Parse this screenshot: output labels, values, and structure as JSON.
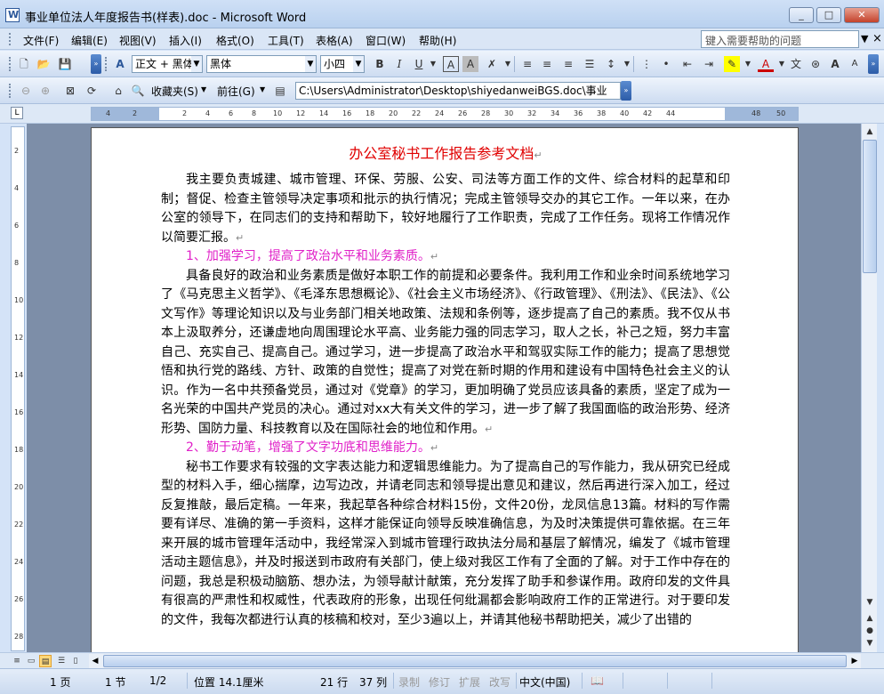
{
  "window": {
    "title": "事业单位法人年度报告书(样表).doc - Microsoft Word",
    "min": "_",
    "max": "□",
    "close": "✕"
  },
  "menu": {
    "items": [
      "文件(F)",
      "编辑(E)",
      "视图(V)",
      "插入(I)",
      "格式(O)",
      "工具(T)",
      "表格(A)",
      "窗口(W)",
      "帮助(H)"
    ],
    "help_placeholder": "键入需要帮助的问题",
    "close": "×"
  },
  "formatting": {
    "style": "正文 + 黑体",
    "font": "黑体",
    "size": "小四"
  },
  "web": {
    "favorites": "收藏夹(S)",
    "goto": "前往(G)",
    "address": "C:\\Users\\Administrator\\Desktop\\shiyedanweiBGS.doc\\事业"
  },
  "ruler": {
    "ticks": [
      "4",
      "2",
      "2",
      "4",
      "6",
      "8",
      "10",
      "12",
      "14",
      "16",
      "18",
      "20",
      "22",
      "24",
      "26",
      "28",
      "30",
      "32",
      "34",
      "36",
      "38",
      "40",
      "42",
      "44",
      "48",
      "50"
    ],
    "vticks": [
      "2",
      "4",
      "6",
      "8",
      "10",
      "12",
      "14",
      "16",
      "18",
      "20",
      "22",
      "24",
      "26",
      "28"
    ]
  },
  "document": {
    "title": "办公室秘书工作报告参考文档",
    "paragraphs": [
      {
        "type": "para",
        "text": "我主要负责城建、城市管理、环保、劳服、公安、司法等方面工作的文件、综合材料的起草和印制；督促、检查主管领导决定事项和批示的执行情况；完成主管领导交办的其它工作。一年以来，在办公室的领导下，在同志们的支持和帮助下，较好地履行了工作职责，完成了工作任务。现将工作情况作以简要汇报。"
      },
      {
        "type": "heading",
        "text": "1、加强学习，提高了政治水平和业务素质。"
      },
      {
        "type": "para",
        "text": "具备良好的政治和业务素质是做好本职工作的前提和必要条件。我利用工作和业余时间系统地学习了《马克思主义哲学》、《毛泽东思想概论》、《社会主义市场经济》、《行政管理》、《刑法》、《民法》、《公文写作》等理论知识以及与业务部门相关地政策、法规和条例等，逐步提高了自己的素质。我不仅从书本上汲取养分，还谦虚地向周围理论水平高、业务能力强的同志学习，取人之长，补己之短，努力丰富自己、充实自己、提高自己。通过学习，进一步提高了政治水平和驾驭实际工作的能力；提高了思想觉悟和执行党的路线、方针、政策的自觉性；提高了对党在新时期的作用和建设有中国特色社会主义的认识。作为一名中共预备党员，通过对《党章》的学习，更加明确了党员应该具备的素质，坚定了成为一名光荣的中国共产党员的决心。通过对xx大有关文件的学习，进一步了解了我国面临的政治形势、经济形势、国防力量、科技教育以及在国际社会的地位和作用。"
      },
      {
        "type": "heading",
        "text": "2、勤于动笔，增强了文字功底和思维能力。"
      },
      {
        "type": "para",
        "text": "秘书工作要求有较强的文字表达能力和逻辑思维能力。为了提高自己的写作能力，我从研究已经成型的材料入手，细心揣摩，边写边改，并请老同志和领导提出意见和建议，然后再进行深入加工，经过反复推敲，最后定稿。一年来，我起草各种综合材料15份，文件20份，龙凤信息13篇。材料的写作需要有详尽、准确的第一手资料，这样才能保证向领导反映准确信息，为及时决策提供可靠依据。在三年来开展的城市管理年活动中，我经常深入到城市管理行政执法分局和基层了解情况，编发了《城市管理活动主题信息》，并及时报送到市政府有关部门，使上级对我区工作有了全面的了解。对于工作中存在的问题，我总是积极动脑筋、想办法，为领导献计献策，充分发挥了助手和参谋作用。政府印发的文件具有很高的严肃性和权威性，代表政府的形象，出现任何纰漏都会影响政府工作的正常进行。对于要印发的文件，我每次都进行认真的核稿和校对，至少3遍以上，并请其他秘书帮助把关，减少了出错的"
      }
    ],
    "para_mark": "↵"
  },
  "status": {
    "page": "1 页",
    "section": "1 节",
    "pages": "1/2",
    "position": "位置 14.1厘米",
    "line": "21 行",
    "col": "37 列",
    "rec": "录制",
    "trk": "修订",
    "ext": "扩展",
    "ovr": "改写",
    "lang": "中文(中国)"
  }
}
